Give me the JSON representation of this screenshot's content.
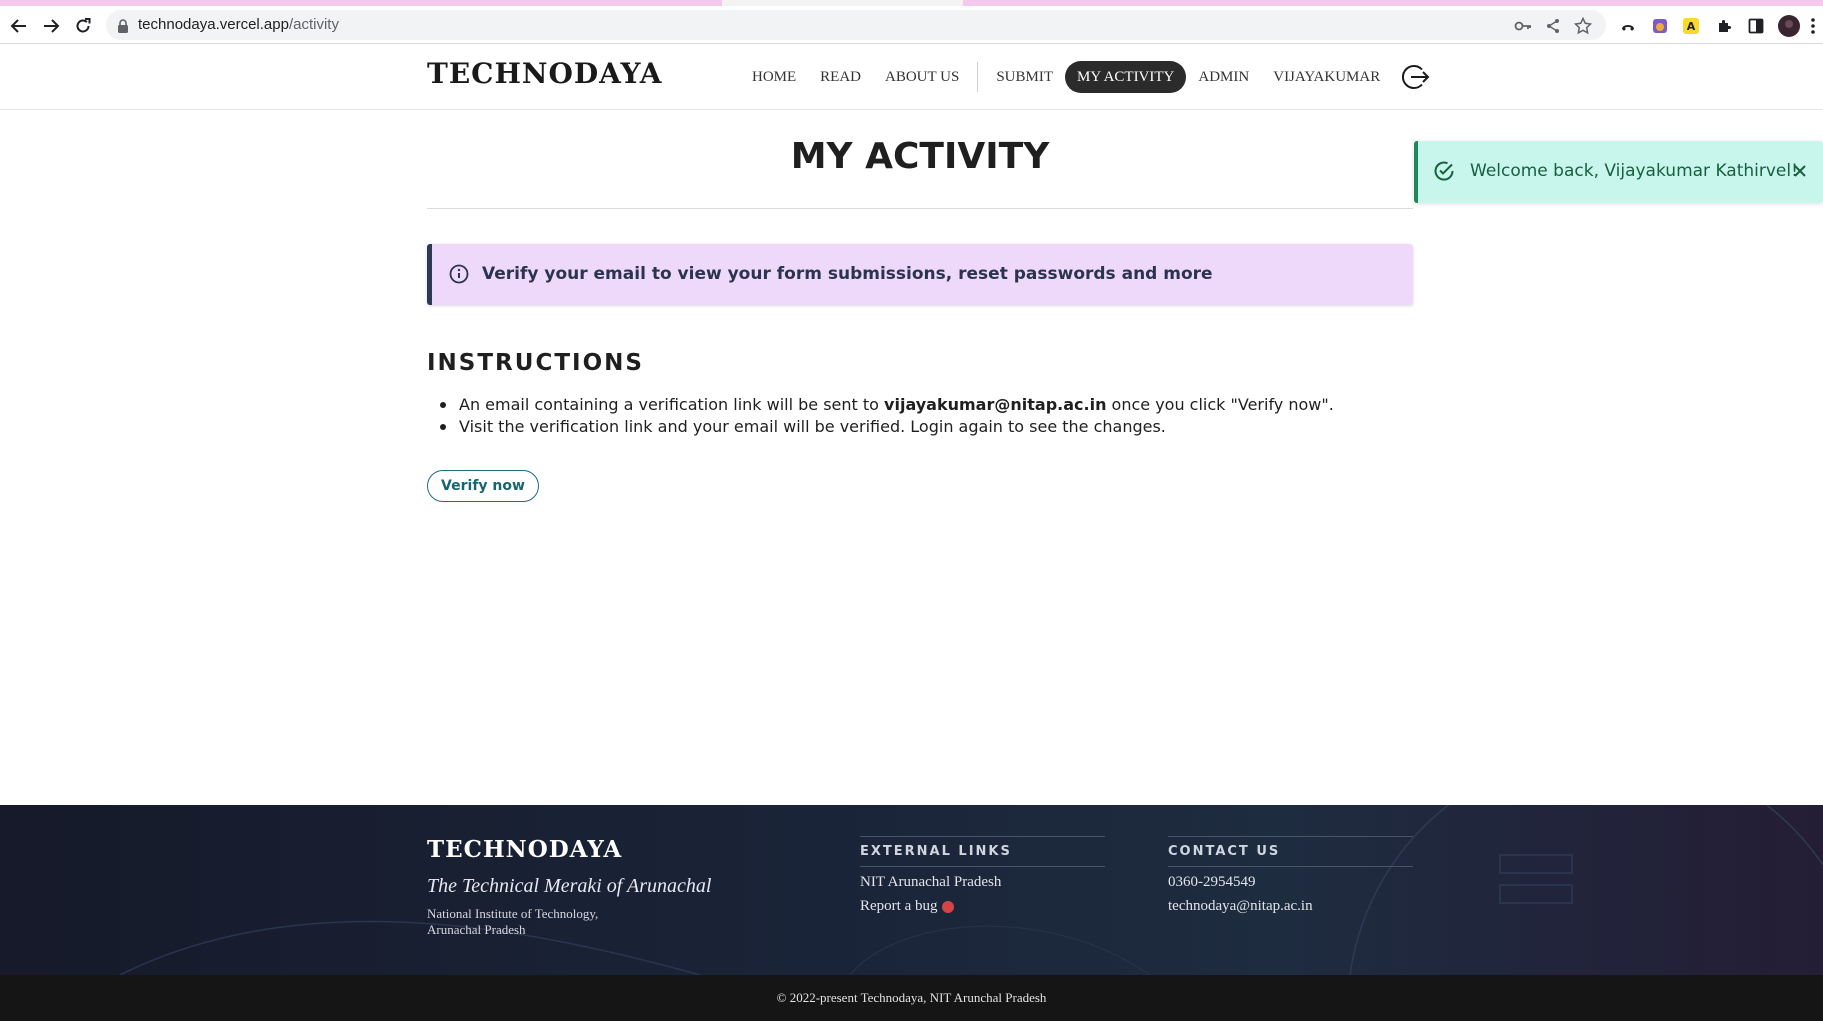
{
  "browser": {
    "url_host": "technodaya.vercel.app",
    "url_path": "/activity",
    "extension_badge": "A"
  },
  "header": {
    "logo": "TECHNODAYA",
    "nav": [
      {
        "label": "HOME"
      },
      {
        "label": "READ"
      },
      {
        "label": "ABOUT US"
      },
      {
        "label": "SUBMIT"
      },
      {
        "label": "MY ACTIVITY",
        "active": true
      },
      {
        "label": "ADMIN"
      },
      {
        "label": "VIJAYAKUMAR"
      }
    ]
  },
  "main": {
    "title": "MY ACTIVITY",
    "alert": "Verify your email to view your form submissions, reset passwords and more",
    "instructions_heading": "INSTRUCTIONS",
    "instruction_1_pre": "An email containing a verification link will be sent to ",
    "instruction_1_email": "vijayakumar@nitap.ac.in",
    "instruction_1_post": " once you click \"Verify now\".",
    "instruction_2": "Visit the verification link and your email will be verified. Login again to see the changes.",
    "verify_button": "Verify now"
  },
  "toast": {
    "message": "Welcome back, Vijayakumar Kathirvel!"
  },
  "footer": {
    "logo": "TECHNODAYA",
    "tagline": "The Technical Meraki of Arunachal",
    "institute_line1": "National Institute of Technology,",
    "institute_line2": "Arunachal Pradesh",
    "external_heading": "EXTERNAL LINKS",
    "external_links": [
      "NIT Arunachal Pradesh",
      "Report a bug"
    ],
    "contact_heading": "CONTACT US",
    "contact_phone": "0360-2954549",
    "contact_email": "technodaya@nitap.ac.in",
    "copyright": "© 2022-present Technodaya, NIT Arunchal Pradesh"
  },
  "colors": {
    "alert_bg": "#efd9fa",
    "toast_bg": "#c9f6ec",
    "accent_teal": "#176570",
    "nav_active_bg": "#2b2b2b"
  }
}
